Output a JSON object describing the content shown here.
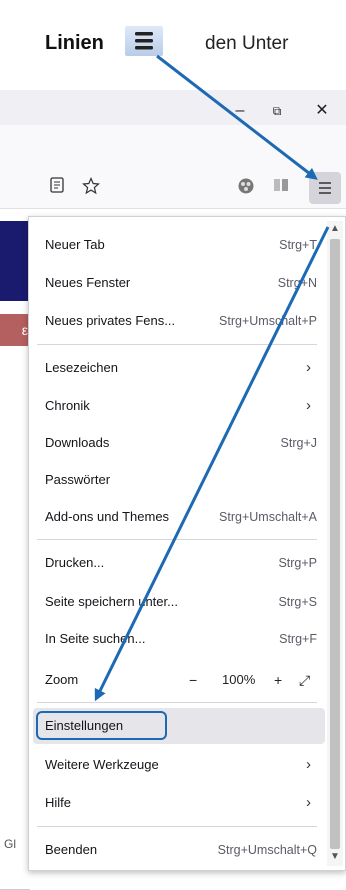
{
  "instruction": {
    "bold": "Linien",
    "text": "den Unter"
  },
  "window": {
    "minimize": "–",
    "restore": "⧉",
    "close": "✕"
  },
  "toolbar": {
    "reader_icon": "reader-view-icon",
    "bookmark_icon": "star-icon",
    "hamburger_icon": "hamburger-menu-icon"
  },
  "page": {
    "red_strip_text": "ε",
    "bottom_glyph": "Gl"
  },
  "menu": {
    "items": [
      {
        "label": "Neuer Tab",
        "shortcut": "Strg+T"
      },
      {
        "label": "Neues Fenster",
        "shortcut": "Strg+N"
      },
      {
        "label": "Neues privates Fens...",
        "shortcut": "Strg+Umschalt+P"
      },
      {
        "label": "Lesezeichen",
        "shortcut": "›"
      },
      {
        "label": "Chronik",
        "shortcut": "›"
      },
      {
        "label": "Downloads",
        "shortcut": "Strg+J"
      },
      {
        "label": "Passwörter",
        "shortcut": ""
      },
      {
        "label": "Add-ons und Themes",
        "shortcut": "Strg+Umschalt+A"
      },
      {
        "label": "Drucken...",
        "shortcut": "Strg+P"
      },
      {
        "label": "Seite speichern unter...",
        "shortcut": "Strg+S"
      },
      {
        "label": "In Seite suchen...",
        "shortcut": "Strg+F"
      },
      {
        "label": "Einstellungen",
        "shortcut": ""
      },
      {
        "label": "Weitere Werkzeuge",
        "shortcut": "›"
      },
      {
        "label": "Hilfe",
        "shortcut": "›"
      },
      {
        "label": "Beenden",
        "shortcut": "Strg+Umschalt+Q"
      }
    ],
    "zoom": {
      "label": "Zoom",
      "minus": "−",
      "value": "100%",
      "plus": "+",
      "fullscreen": "⤢"
    }
  },
  "colors": {
    "arrow": "#1c69b4",
    "highlight": "#e6e6ea"
  }
}
